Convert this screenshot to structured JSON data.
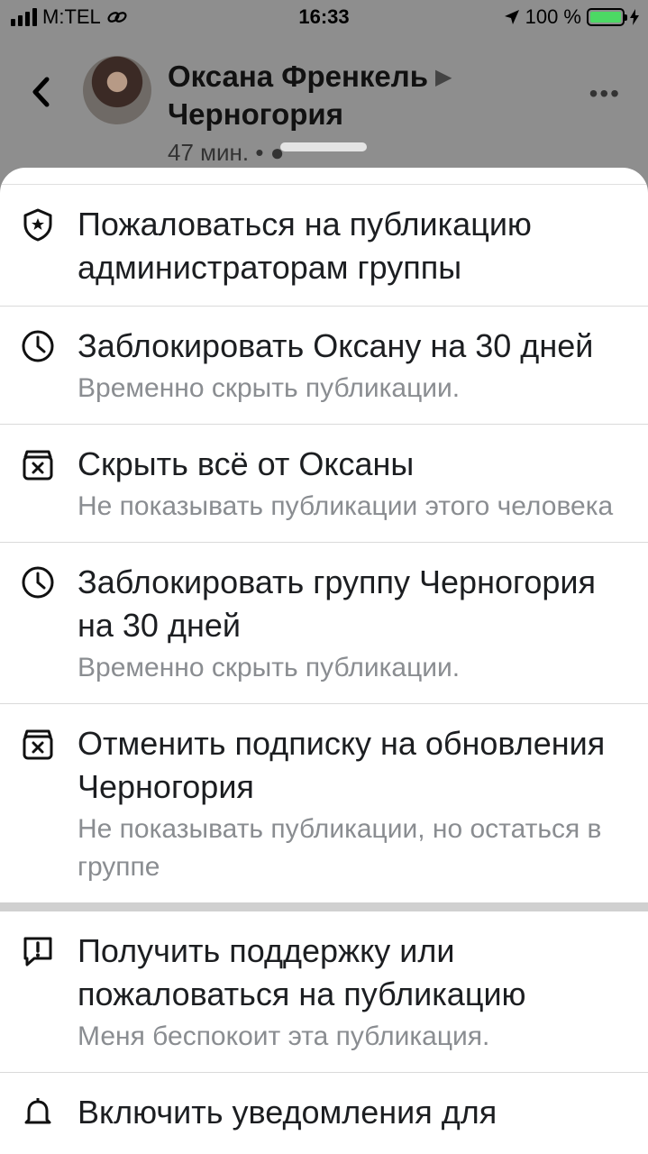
{
  "status_bar": {
    "carrier": "M:TEL",
    "time": "16:33",
    "battery_percent": "100 %",
    "battery_color": "#4cd964"
  },
  "post": {
    "author": "Оксана Френкель",
    "group": "Черногория",
    "time": "47 мин. •"
  },
  "menu": {
    "items": [
      {
        "icon": "shield-star-icon",
        "title": "Пожаловаться на публикацию администраторам группы",
        "subtitle": ""
      },
      {
        "icon": "clock-icon",
        "title": "Заблокировать Оксану на 30 дней",
        "subtitle": "Временно скрыть публикации."
      },
      {
        "icon": "hide-box-icon",
        "title": "Скрыть всё от Оксаны",
        "subtitle": "Не показывать публикации этого человека"
      },
      {
        "icon": "clock-icon",
        "title": "Заблокировать группу Черногория на 30 дней",
        "subtitle": "Временно скрыть публикации."
      },
      {
        "icon": "hide-box-icon",
        "title": "Отменить подписку на обновления Черногория",
        "subtitle": "Не показывать публикации, но остаться в группе"
      },
      {
        "icon": "report-bubble-icon",
        "title": "Получить поддержку или пожаловаться на публикацию",
        "subtitle": "Меня беспокоит эта публикация."
      },
      {
        "icon": "bell-icon",
        "title": "Включить уведомления для",
        "subtitle": ""
      }
    ]
  }
}
